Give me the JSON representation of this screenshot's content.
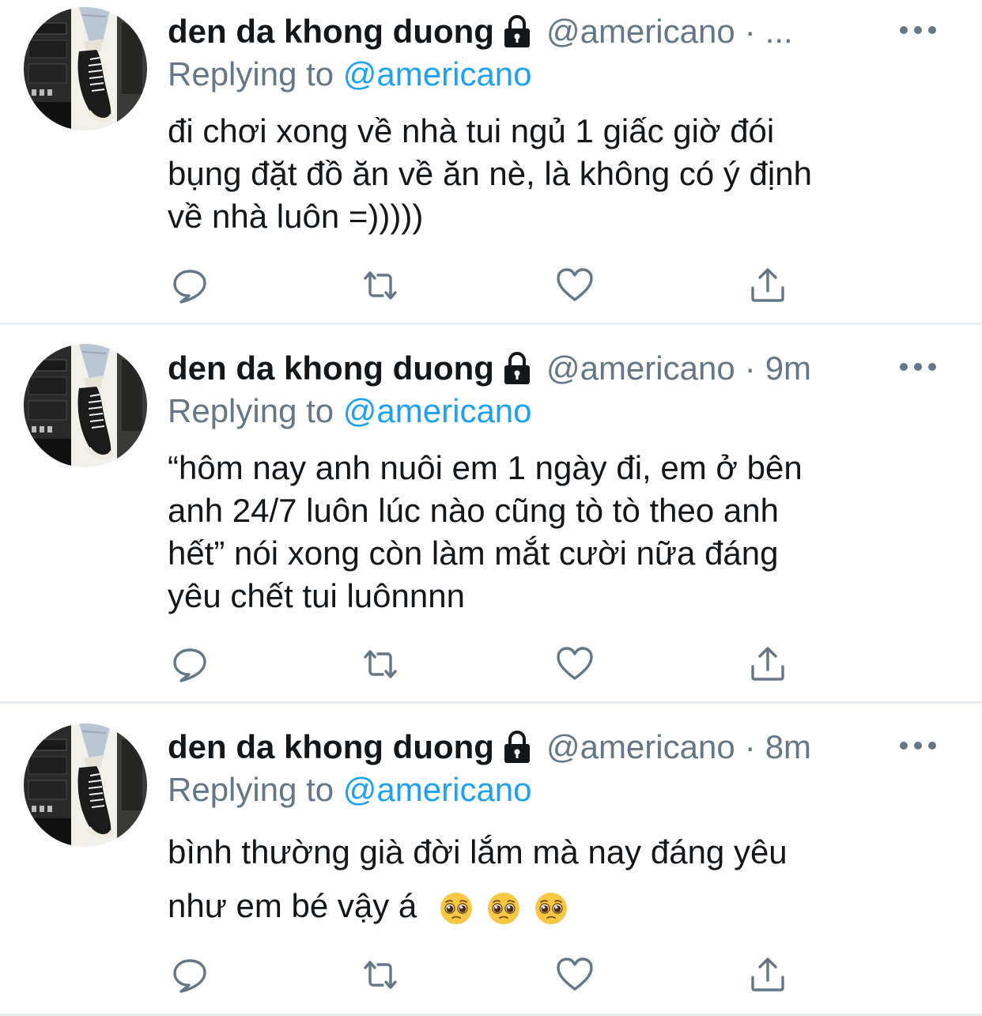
{
  "tweets": [
    {
      "name": "den da khong duong",
      "handle": "@americano",
      "separator": "·",
      "time": "...",
      "replying_prefix": "Replying to",
      "replying_to": "@americano",
      "text_lines": [
        "đi chơi xong về nhà tui ngủ 1 giấc giờ đói",
        "bụng đặt đồ ăn về ăn nè, là không có ý định",
        "về nhà luôn =)))))"
      ]
    },
    {
      "name": "den da khong duong",
      "handle": "@americano",
      "separator": "·",
      "time": "9m",
      "replying_prefix": "Replying to",
      "replying_to": "@americano",
      "text_lines": [
        "“hôm nay anh nuôi em 1 ngày đi, em ở bên",
        "anh 24/7 luôn lúc nào cũng tò tò theo anh",
        "hết” nói xong còn làm mắt cười nữa đáng",
        "yêu chết tui luônnnn"
      ]
    },
    {
      "name": "den da khong duong",
      "handle": "@americano",
      "separator": "·",
      "time": "8m",
      "replying_prefix": "Replying to",
      "replying_to": "@americano",
      "text_lines": [
        "bình thường già đời lắm mà nay đáng yêu",
        "như em bé vậy á"
      ],
      "emoji": [
        "pleading-face",
        "pleading-face",
        "pleading-face"
      ]
    }
  ],
  "icons": {
    "lock": "lock-icon",
    "more": "more-icon",
    "reply": "reply-icon",
    "retweet": "retweet-icon",
    "like": "heart-icon",
    "share": "share-icon"
  },
  "colors": {
    "text": "#14171a",
    "secondary": "#657786",
    "mention": "#1da1f2",
    "divider": "#e6ecf0"
  }
}
